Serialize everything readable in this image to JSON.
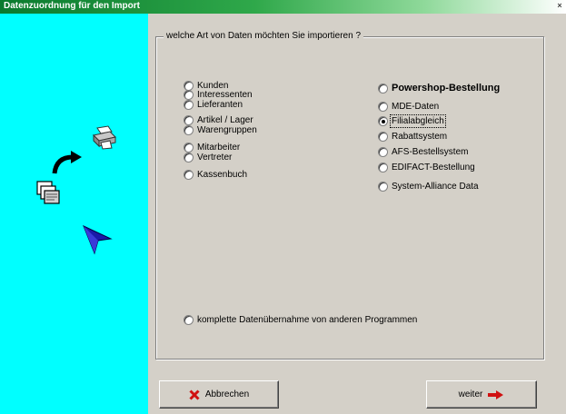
{
  "window": {
    "title": "Datenzuordnung für den Import",
    "close_glyph": "×"
  },
  "colors": {
    "sidebar": "#00ffff",
    "title_start": "#0a7a2e",
    "accent_red": "#d01010"
  },
  "icons": {
    "sidebar": [
      "printer-icon",
      "curved-arrow-icon",
      "documents-stack-icon",
      "blue-arrow-cursor-icon"
    ],
    "cancel": "red-x-icon",
    "next": "red-arrow-right-icon"
  },
  "group": {
    "title": "welche Art von Daten möchten Sie importieren ?",
    "left_options": [
      {
        "label": "Kunden",
        "checked": false
      },
      {
        "label": "Interessenten",
        "checked": false
      },
      {
        "label": "Lieferanten",
        "checked": false
      },
      {
        "label": "Artikel / Lager",
        "checked": false
      },
      {
        "label": "Warengruppen",
        "checked": false
      },
      {
        "label": "Mitarbeiter",
        "checked": false
      },
      {
        "label": "Vertreter",
        "checked": false
      },
      {
        "label": "Kassenbuch",
        "checked": false
      }
    ],
    "right_options": [
      {
        "label": "Powershop-Bestellung",
        "checked": false,
        "bold": true
      },
      {
        "label": "MDE-Daten",
        "checked": false
      },
      {
        "label": "Filialabgleich",
        "checked": true,
        "focused": true
      },
      {
        "label": "Rabattsystem",
        "checked": false
      },
      {
        "label": "AFS-Bestellsystem",
        "checked": false
      },
      {
        "label": "EDIFACT-Bestellung",
        "checked": false
      },
      {
        "label": "System-Alliance Data",
        "checked": false
      }
    ],
    "bottom_option": {
      "label": "komplette Datenübernahme von anderen Programmen",
      "checked": false
    }
  },
  "buttons": {
    "cancel_label": "Abbrechen",
    "next_label": "weiter"
  }
}
